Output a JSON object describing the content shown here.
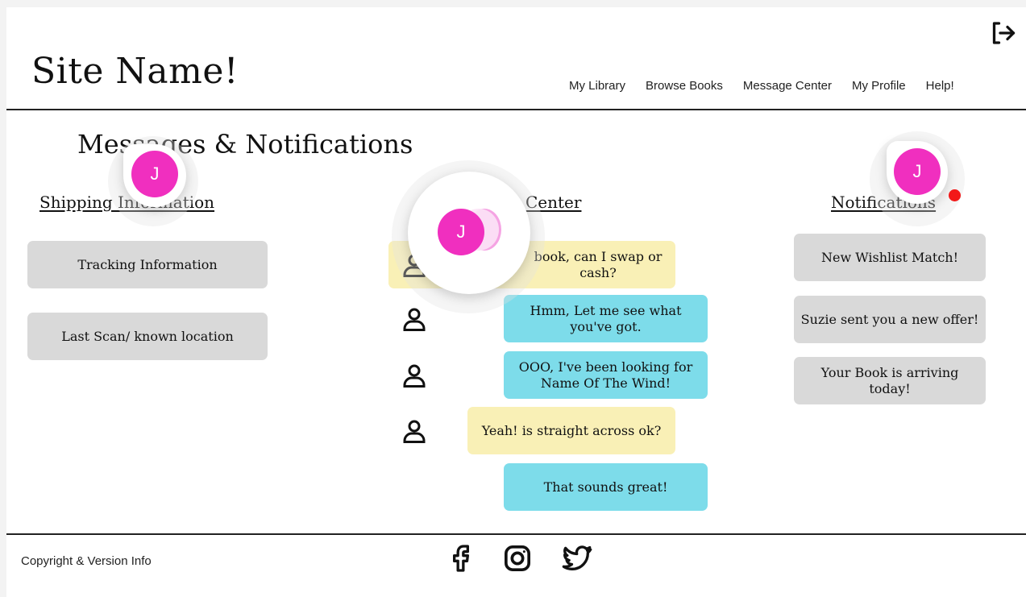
{
  "site": {
    "name": "Site Name!"
  },
  "nav": {
    "items": [
      "My Library",
      "Browse Books",
      "Message Center",
      "My Profile",
      "Help!"
    ]
  },
  "page": {
    "title": "Messages & Notifications"
  },
  "shipping": {
    "heading": "Shipping Information",
    "items": [
      "Tracking Information",
      "Last Scan/ known location"
    ]
  },
  "messages": {
    "heading": "Center",
    "items": [
      {
        "text": "book, can I swap or cash?",
        "color": "#f9f0b6"
      },
      {
        "text": "Hmm, Let me see what you've got.",
        "color": "#7ddcea"
      },
      {
        "text": "OOO, I've been looking for Name Of The Wind!",
        "color": "#7ddcea"
      },
      {
        "text": "Yeah! is straight across ok?",
        "color": "#f9f0b6"
      },
      {
        "text": "That sounds great!",
        "color": "#7ddcea"
      }
    ]
  },
  "notifications": {
    "heading": "Notifications",
    "items": [
      "New Wishlist Match!",
      "Suzie sent you a new offer!",
      "Your Book is arriving today!"
    ]
  },
  "avatars": {
    "initial": "J",
    "color": "#f02fbf"
  },
  "footer": {
    "copyright": "Copyright & Version Info",
    "social": [
      "facebook-icon",
      "instagram-icon",
      "twitter-icon"
    ]
  },
  "icons": {
    "logout": "logout-icon",
    "person": "person-icon",
    "notification_dot": "#f21818"
  }
}
